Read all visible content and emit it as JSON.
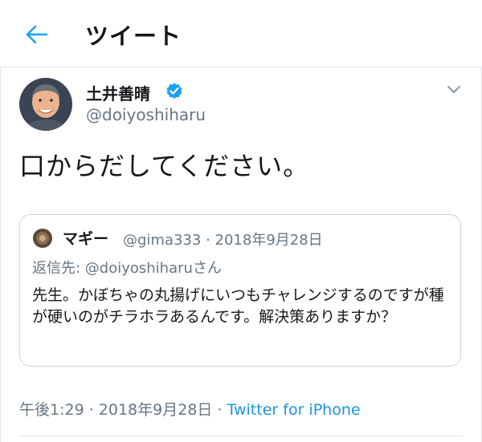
{
  "header": {
    "title": "ツイート",
    "back_icon": "back-arrow-icon"
  },
  "tweet": {
    "author_name": "土井善晴",
    "author_handle": "@doiyoshiharu",
    "verified": true,
    "text": "口からだしてください。",
    "timestamp": "午後1:29 · 2018年9月28日",
    "separator": " · ",
    "source": "Twitter for iPhone"
  },
  "quoted_tweet": {
    "author_name": "マギー",
    "author_handle": "@gima333",
    "date": "2018年9月28日",
    "meta": "@gima333 · 2018年9月28日",
    "reply_to": "返信先: @doiyoshiharuさん",
    "text": "先生。かぼちゃの丸揚げにいつもチャレンジするのですが種が硬いのがチラホラあるんです。解決策ありますか？"
  },
  "colors": {
    "accent": "#1da1f2",
    "link": "#1b95e0",
    "secondary_text": "#657786",
    "primary_text": "#14171a",
    "border": "#e1e8ed"
  }
}
